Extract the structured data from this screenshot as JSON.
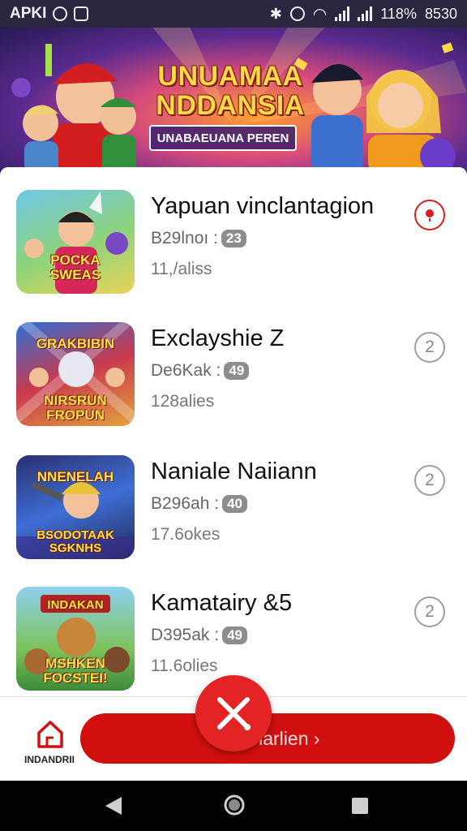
{
  "status_bar": {
    "left_label": "APKI",
    "battery": "118%",
    "time": "8530"
  },
  "banner": {
    "title_line1": "UNUAMAA",
    "title_line2": "NDDANSIA",
    "subtitle": "UNABAEUANA PEREN"
  },
  "items": [
    {
      "title": "Yapuan vinclantagion",
      "sub_prefix": "B29lnoı :",
      "badge": "23",
      "meta": "11,/aliss",
      "thumb_text": [
        "POCKA",
        "SWEAS"
      ],
      "action": "alert"
    },
    {
      "title": "Exclayshie Z",
      "sub_prefix": "De6Kak :",
      "badge": "49",
      "meta": "128alies",
      "thumb_text": [
        "GRAKBIBIN",
        "NIRSRUN",
        "FROPUN"
      ],
      "action": "2"
    },
    {
      "title": "Naniale Naiiann",
      "sub_prefix": "B296ah :",
      "badge": "40",
      "meta": "17.6okes",
      "thumb_text": [
        "NNENELAH",
        "BSODOTAAK",
        "SGKNHS"
      ],
      "action": "2"
    },
    {
      "title": "Kamatairy &5",
      "sub_prefix": "D395ak :",
      "badge": "49",
      "meta": "11.6olies",
      "thumb_text": [
        "INDAKAN",
        "MSHKEN",
        "FOCSTEI!"
      ],
      "action": "2"
    }
  ],
  "bottom_bar": {
    "home_label": "INDANDRII",
    "cta_label": "Dowrlarlien ›"
  },
  "colors": {
    "accent_red": "#d20f0f",
    "fab_red": "#e42424"
  }
}
